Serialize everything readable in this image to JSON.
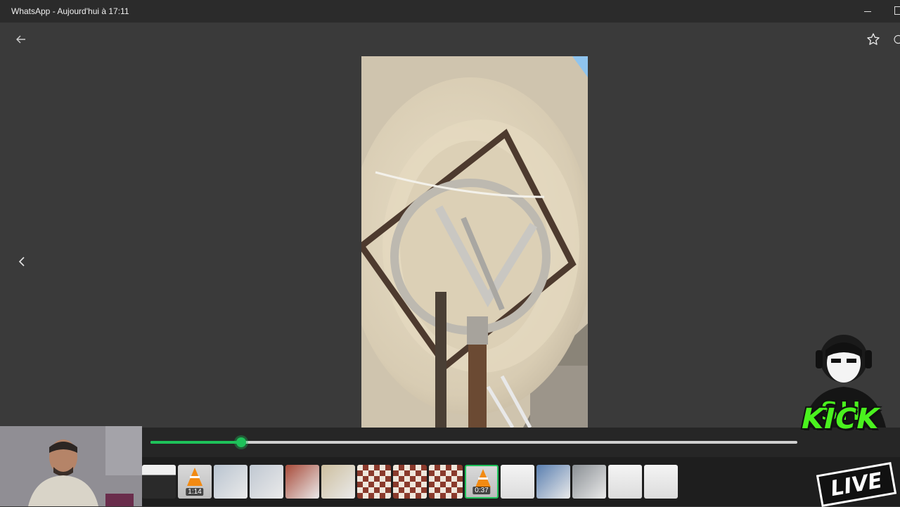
{
  "window": {
    "title": "WhatsApp - Aujourd'hui à 17:11"
  },
  "viewer": {
    "icons": {
      "back": "arrow-left-icon",
      "previous": "chevron-left-icon",
      "star": "star-icon",
      "more": "circle-icon"
    },
    "progress_fraction": 0.14
  },
  "thumbnails": [
    {
      "kind": "document",
      "duration": ""
    },
    {
      "kind": "video",
      "duration": "1:14"
    },
    {
      "kind": "photo",
      "duration": ""
    },
    {
      "kind": "photo",
      "duration": ""
    },
    {
      "kind": "photo",
      "duration": ""
    },
    {
      "kind": "photo",
      "duration": ""
    },
    {
      "kind": "photo",
      "duration": ""
    },
    {
      "kind": "photo",
      "duration": ""
    },
    {
      "kind": "photo",
      "duration": ""
    },
    {
      "kind": "video",
      "duration": "0:37",
      "selected": true
    },
    {
      "kind": "screenshot",
      "duration": ""
    },
    {
      "kind": "photo",
      "duration": ""
    },
    {
      "kind": "photo",
      "duration": ""
    },
    {
      "kind": "screenshot",
      "duration": ""
    },
    {
      "kind": "screenshot",
      "duration": ""
    }
  ],
  "overlay": {
    "brand_top": "SH",
    "brand_middle": "KICK",
    "brand_bottom": "LIVE",
    "accent_color": "#4af21e",
    "progress_color": "#1ec25a"
  }
}
